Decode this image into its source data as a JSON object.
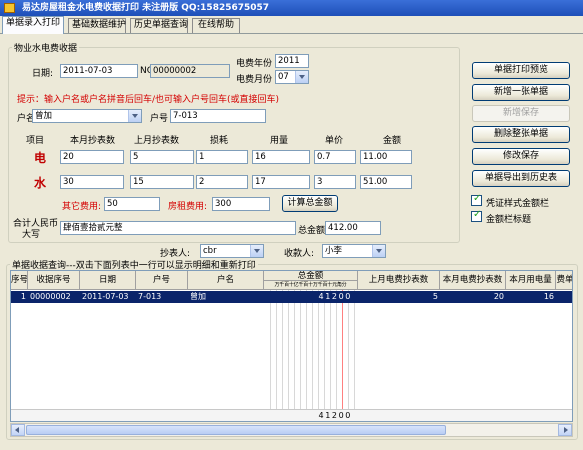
{
  "title": "易达房屋租金水电费收据打印   未注册版   QQ:15825675057",
  "tabs": [
    "单据录入打印",
    "基础数据维护",
    "历史单据查询",
    "在线帮助"
  ],
  "group_title": "物业水电费收据",
  "date_label": "日期:",
  "date_value": "2011-07-03",
  "no_label": "NO",
  "no_value": "00000002",
  "year_label": "电费年份",
  "year_value": "2011",
  "month_label": "电费月份",
  "month_value": "07",
  "hint": "提示：输入户名或户名拼音后回车/也可输入户号回车(或直接回车)",
  "hm_label": "户名",
  "hm_value": "曾加",
  "hh_label": "户号",
  "hh_value": "7-013",
  "cols": {
    "item": "项目",
    "this_reading": "本月抄表数",
    "last_reading": "上月抄表数",
    "loss": "损耗",
    "usage": "用量",
    "price": "单价",
    "amount": "金额"
  },
  "elec": {
    "label": "电",
    "this": "20",
    "last": "5",
    "loss": "1",
    "usage": "16",
    "price": "0.7",
    "amount": "11.00"
  },
  "water": {
    "label": "水",
    "this": "30",
    "last": "15",
    "loss": "2",
    "usage": "17",
    "price": "3",
    "amount": "51.00"
  },
  "other_label": "其它费用:",
  "other_value": "50",
  "rent_label": "房租费用:",
  "rent_value": "300",
  "calc_button": "计算总金额",
  "rmb_label_1": "合计人民币",
  "rmb_label_2": "大写",
  "rmb_value": "肆佰壹拾贰元整",
  "total_label": "总金额",
  "total_value": "412.00",
  "reader_label": "抄表人:",
  "reader_value": "cbr",
  "payee_label": "收款人:",
  "payee_value": "小李",
  "buttons": {
    "preview": "单据打印预览",
    "new": "新增一张单据",
    "save_new": "新增保存",
    "delete": "删除整张单据",
    "save_edit": "修改保存",
    "export": "单据导出到历史表"
  },
  "checks": {
    "voucher_style": "凭证样式金额栏",
    "amount_title": "金额栏标题"
  },
  "query_title": "单据收据查询---双击下面列表中一行可以显示明细和重新打印",
  "grid": {
    "headers": [
      "序号",
      "收据序号",
      "日期",
      "户号",
      "户名",
      "总金额",
      "上月电费抄表数",
      "本月电费抄表数",
      "本月用电量",
      "费单"
    ],
    "amount_subheader": "万千百十亿千百十万千百十元角分",
    "row": {
      "seq": "1",
      "receipt_no": "00000002",
      "date": "2011-07-03",
      "unit": "7-013",
      "name": "曾加",
      "amount": "41200",
      "last_elec": "5",
      "this_elec": "20",
      "usage": "16"
    },
    "footer_total": "41200"
  }
}
